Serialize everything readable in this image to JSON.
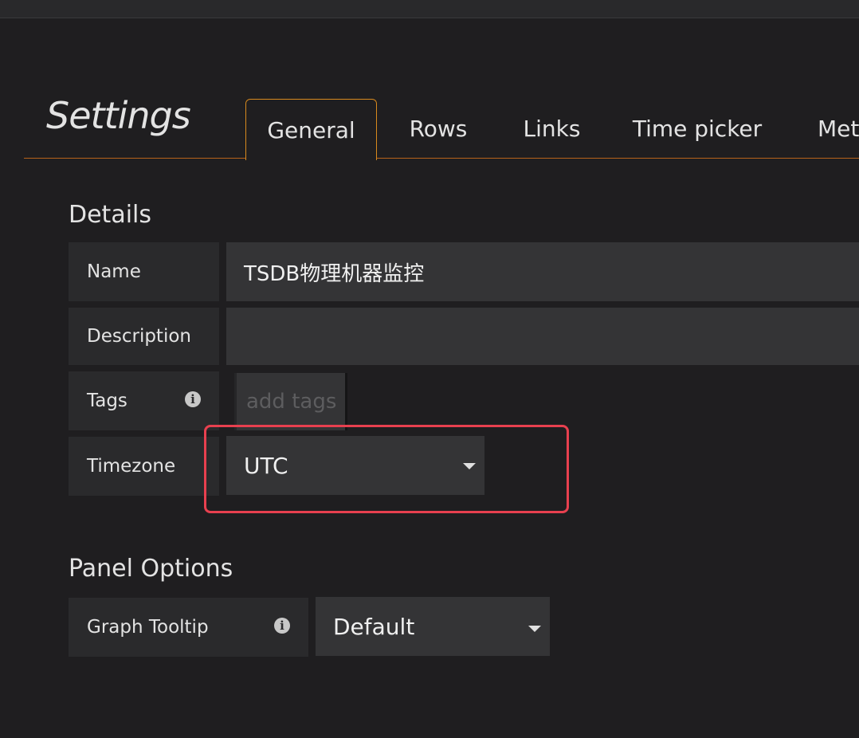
{
  "page": {
    "title": "Settings"
  },
  "tabs": [
    {
      "label": "General",
      "active": true
    },
    {
      "label": "Rows"
    },
    {
      "label": "Links"
    },
    {
      "label": "Time picker"
    },
    {
      "label": "Metadata"
    }
  ],
  "details": {
    "section_title": "Details",
    "name_label": "Name",
    "name_value": "TSDB物理机器监控",
    "description_label": "Description",
    "description_value": "",
    "tags_label": "Tags",
    "tags_placeholder": "add tags",
    "timezone_label": "Timezone",
    "timezone_value": "UTC"
  },
  "panel_options": {
    "section_title": "Panel Options",
    "graph_tooltip_label": "Graph Tooltip",
    "graph_tooltip_value": "Default"
  },
  "colors": {
    "background": "#1f1e20",
    "accent": "#eb7b18",
    "highlight": "#e8404f"
  },
  "icons": {
    "info": "info-icon",
    "caret": "caret-down-icon"
  }
}
